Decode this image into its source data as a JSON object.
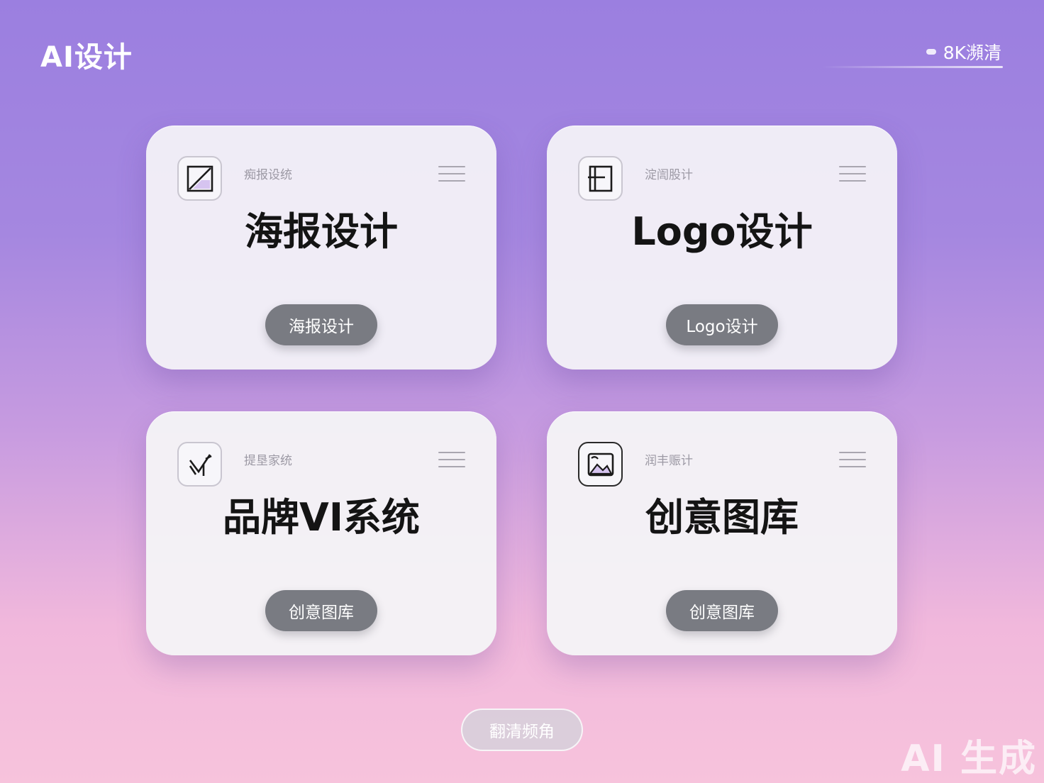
{
  "header": {
    "app_title": "AI设计",
    "resolution_label": "8K瀕清"
  },
  "cards": [
    {
      "tag": "痴报设统",
      "title": "海报设计",
      "button": "海报设计",
      "icon": "poster-icon"
    },
    {
      "tag": "淀訚股计",
      "title": "Logo设计",
      "button": "Logo设计",
      "icon": "logo-icon"
    },
    {
      "tag": "提垦家统",
      "title": "品牌VI系统",
      "button": "创意图库",
      "icon": "vi-icon"
    },
    {
      "tag": "润丰赈计",
      "title": "创意图库",
      "button": "创意图库",
      "icon": "image-icon"
    }
  ],
  "footer": {
    "button": "翻清频角"
  },
  "watermark": "AI 生成"
}
